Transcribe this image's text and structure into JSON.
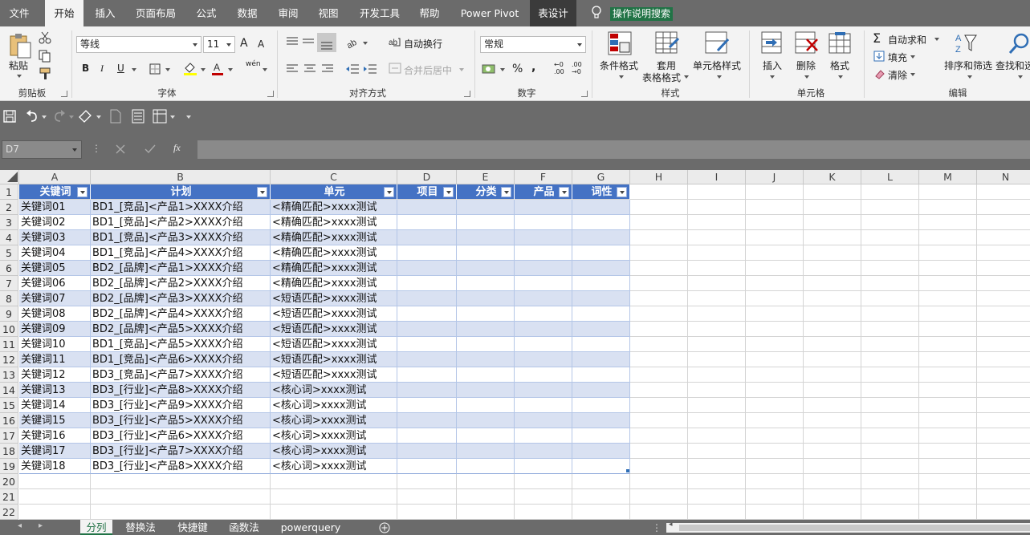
{
  "menu": {
    "tabs": [
      "文件",
      "开始",
      "插入",
      "页面布局",
      "公式",
      "数据",
      "审阅",
      "视图",
      "开发工具",
      "帮助",
      "Power Pivot",
      "表设计"
    ],
    "tell_me": "操作说明搜索"
  },
  "ribbon": {
    "clipboard": {
      "paste": "粘贴",
      "label": "剪贴板"
    },
    "font": {
      "name": "等线",
      "size": "11",
      "bold": "B",
      "italic": "I",
      "underline": "U",
      "label": "字体",
      "grow": "A",
      "shrink": "A",
      "phonetic": "wén"
    },
    "alignment": {
      "wrap": "自动换行",
      "merge": "合并后居中",
      "label": "对齐方式"
    },
    "number": {
      "format": "常规",
      "percent": "%",
      "comma": ",",
      "inc_decimal": "←0 .00",
      "dec_decimal": ".00 →0",
      "label": "数字"
    },
    "styles": {
      "conditional": "条件格式",
      "table_format_1": "套用",
      "table_format_2": "表格格式",
      "cell_styles": "单元格样式",
      "label": "样式"
    },
    "cells": {
      "insert": "插入",
      "delete": "删除",
      "format": "格式",
      "label": "单元格"
    },
    "editing": {
      "autosum": "自动求和",
      "fill": "填充",
      "clear": "清除",
      "sort_filter": "排序和筛选",
      "find_select": "查找和选",
      "label": "编辑"
    }
  },
  "formula_bar": {
    "name_box": "D7",
    "fx": "fx",
    "formula": ""
  },
  "columns": [
    "A",
    "B",
    "C",
    "D",
    "E",
    "F",
    "G",
    "H",
    "I",
    "J",
    "K",
    "L",
    "M",
    "N"
  ],
  "table": {
    "headers": [
      "关键词",
      "计划",
      "单元",
      "项目",
      "分类",
      "产品",
      "词性"
    ],
    "rows": [
      [
        "关键词01",
        "BD1_[竞品]<产品1>XXXX介绍",
        "<精确匹配>xxxx测试"
      ],
      [
        "关键词02",
        "BD1_[竞品]<产品2>XXXX介绍",
        "<精确匹配>xxxx测试"
      ],
      [
        "关键词03",
        "BD1_[竞品]<产品3>XXXX介绍",
        "<精确匹配>xxxx测试"
      ],
      [
        "关键词04",
        "BD1_[竞品]<产品4>XXXX介绍",
        "<精确匹配>xxxx测试"
      ],
      [
        "关键词05",
        "BD2_[品牌]<产品1>XXXX介绍",
        "<精确匹配>xxxx测试"
      ],
      [
        "关键词06",
        "BD2_[品牌]<产品2>XXXX介绍",
        "<精确匹配>xxxx测试"
      ],
      [
        "关键词07",
        "BD2_[品牌]<产品3>XXXX介绍",
        "<短语匹配>xxxx测试"
      ],
      [
        "关键词08",
        "BD2_[品牌]<产品4>XXXX介绍",
        "<短语匹配>xxxx测试"
      ],
      [
        "关键词09",
        "BD2_[品牌]<产品5>XXXX介绍",
        "<短语匹配>xxxx测试"
      ],
      [
        "关键词10",
        "BD1_[竞品]<产品5>XXXX介绍",
        "<短语匹配>xxxx测试"
      ],
      [
        "关键词11",
        "BD1_[竞品]<产品6>XXXX介绍",
        "<短语匹配>xxxx测试"
      ],
      [
        "关键词12",
        "BD3_[竞品]<产品7>XXXX介绍",
        "<短语匹配>xxxx测试"
      ],
      [
        "关键词13",
        "BD3_[行业]<产品8>XXXX介绍",
        "<核心词>xxxx测试"
      ],
      [
        "关键词14",
        "BD3_[行业]<产品9>XXXX介绍",
        "<核心词>xxxx测试"
      ],
      [
        "关键词15",
        "BD3_[行业]<产品5>XXXX介绍",
        "<核心词>xxxx测试"
      ],
      [
        "关键词16",
        "BD3_[行业]<产品6>XXXX介绍",
        "<核心词>xxxx测试"
      ],
      [
        "关键词17",
        "BD3_[行业]<产品7>XXXX介绍",
        "<核心词>xxxx测试"
      ],
      [
        "关键词18",
        "BD3_[行业]<产品8>XXXX介绍",
        "<核心词>xxxx测试"
      ]
    ],
    "header_color": "#4472c4",
    "band_color": "#d9e1f2"
  },
  "row_numbers": [
    "1",
    "2",
    "3",
    "4",
    "5",
    "6",
    "7",
    "8",
    "9",
    "10",
    "11",
    "12",
    "13",
    "14",
    "15",
    "16",
    "17",
    "18",
    "19",
    "20",
    "21",
    "22"
  ],
  "sheets": [
    "分列",
    "替换法",
    "快捷键",
    "函数法",
    "powerquery"
  ],
  "colors": {
    "accent": "#217346",
    "chrome": "#6b6b6b",
    "ribbon": "#f3f3f3"
  }
}
